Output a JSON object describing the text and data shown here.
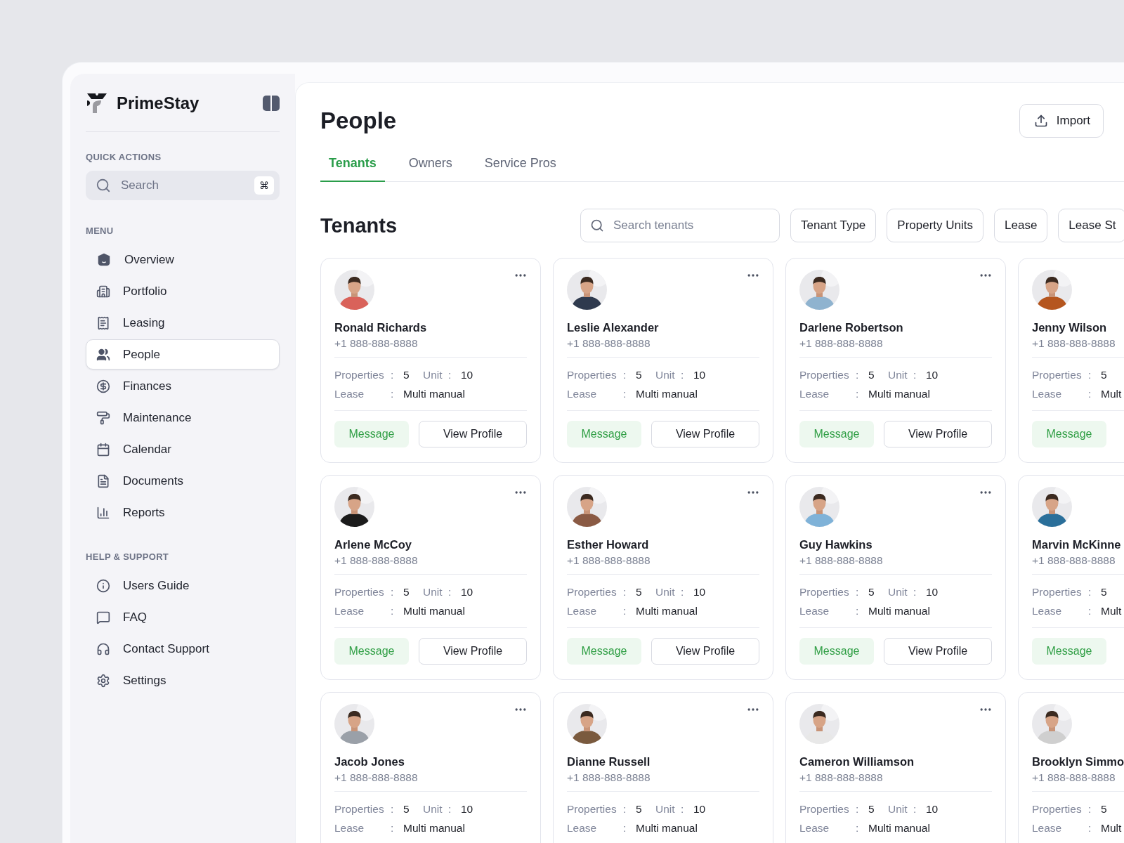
{
  "app": {
    "name": "PrimeStay"
  },
  "sidebar": {
    "quick_actions_label": "QUICK ACTIONS",
    "search": {
      "placeholder": "Search",
      "shortcut": "⌘"
    },
    "menu_label": "MENU",
    "menu": [
      {
        "label": "Overview",
        "selected": false
      },
      {
        "label": "Portfolio",
        "selected": false
      },
      {
        "label": "Leasing",
        "selected": false
      },
      {
        "label": "People",
        "selected": true
      },
      {
        "label": "Finances",
        "selected": false
      },
      {
        "label": "Maintenance",
        "selected": false
      },
      {
        "label": "Calendar",
        "selected": false
      },
      {
        "label": "Documents",
        "selected": false
      },
      {
        "label": "Reports",
        "selected": false
      }
    ],
    "help_label": "HELP & SUPPORT",
    "help": [
      {
        "label": "Users Guide",
        "selected": false
      },
      {
        "label": "FAQ",
        "selected": false
      },
      {
        "label": "Contact Support",
        "selected": false
      },
      {
        "label": "Settings",
        "selected": false
      }
    ]
  },
  "page": {
    "title": "People",
    "import_button": "Import",
    "tabs": [
      {
        "label": "Tenants",
        "selected": true
      },
      {
        "label": "Owners",
        "selected": false
      },
      {
        "label": "Service Pros",
        "selected": false
      }
    ],
    "section_title": "Tenants",
    "search": {
      "placeholder": "Search tenants"
    },
    "filters": [
      "Tenant Type",
      "Property Units",
      "Lease",
      "Lease St"
    ],
    "cards": [
      {
        "name": "Ronald Richards",
        "phone": "+1 888-888-8888",
        "menu": true,
        "properties_label": "Properties",
        "properties_colon": ":",
        "properties": "5",
        "unit_label": "Unit",
        "unit_colon": ":",
        "unit": "10",
        "lease_label": "Lease",
        "lease_colon": ":",
        "lease": "Multi manual",
        "actions": [
          "Message",
          "View Profile"
        ]
      },
      {
        "name": "Leslie Alexander",
        "phone": "+1 888-888-8888",
        "menu": true,
        "properties_label": "Properties",
        "properties_colon": ":",
        "properties": "5",
        "unit_label": "Unit",
        "unit_colon": ":",
        "unit": "10",
        "lease_label": "Lease",
        "lease_colon": ":",
        "lease": "Multi manual",
        "actions": [
          "Message",
          "View Profile"
        ]
      },
      {
        "name": "Darlene Robertson",
        "phone": "+1 888-888-8888",
        "menu": true,
        "properties_label": "Properties",
        "properties_colon": ":",
        "properties": "5",
        "unit_label": "Unit",
        "unit_colon": ":",
        "unit": "10",
        "lease_label": "Lease",
        "lease_colon": ":",
        "lease": "Multi manual",
        "actions": [
          "Message",
          "View Profile"
        ]
      },
      {
        "name": "Jenny Wilson",
        "phone": "+1 888-888-8888",
        "menu": false,
        "properties_label": "Properties",
        "properties_colon": ":",
        "properties": "5",
        "lease_label": "Lease",
        "lease_colon": ":",
        "lease": "Mult",
        "actions": [
          "Message"
        ]
      },
      {
        "name": "Arlene McCoy",
        "phone": "+1 888-888-8888",
        "menu": true,
        "properties_label": "Properties",
        "properties_colon": ":",
        "properties": "5",
        "unit_label": "Unit",
        "unit_colon": ":",
        "unit": "10",
        "lease_label": "Lease",
        "lease_colon": ":",
        "lease": "Multi manual",
        "actions": [
          "Message",
          "View Profile"
        ]
      },
      {
        "name": "Esther Howard",
        "phone": "+1 888-888-8888",
        "menu": true,
        "properties_label": "Properties",
        "properties_colon": ":",
        "properties": "5",
        "unit_label": "Unit",
        "unit_colon": ":",
        "unit": "10",
        "lease_label": "Lease",
        "lease_colon": ":",
        "lease": "Multi manual",
        "actions": [
          "Message",
          "View Profile"
        ]
      },
      {
        "name": "Guy Hawkins",
        "phone": "+1 888-888-8888",
        "menu": true,
        "properties_label": "Properties",
        "properties_colon": ":",
        "properties": "5",
        "unit_label": "Unit",
        "unit_colon": ":",
        "unit": "10",
        "lease_label": "Lease",
        "lease_colon": ":",
        "lease": "Multi manual",
        "actions": [
          "Message",
          "View Profile"
        ]
      },
      {
        "name": "Marvin McKinne",
        "phone": "+1 888-888-8888",
        "menu": false,
        "properties_label": "Properties",
        "properties_colon": ":",
        "properties": "5",
        "lease_label": "Lease",
        "lease_colon": ":",
        "lease": "Mult",
        "actions": [
          "Message"
        ]
      },
      {
        "name": "Jacob Jones",
        "phone": "+1 888-888-8888",
        "menu": true,
        "properties_label": "Properties",
        "properties_colon": ":",
        "properties": "5",
        "unit_label": "Unit",
        "unit_colon": ":",
        "unit": "10",
        "lease_label": "Lease",
        "lease_colon": ":",
        "lease": "Multi manual"
      },
      {
        "name": "Dianne Russell",
        "phone": "+1 888-888-8888",
        "menu": true,
        "properties_label": "Properties",
        "properties_colon": ":",
        "properties": "5",
        "unit_label": "Unit",
        "unit_colon": ":",
        "unit": "10",
        "lease_label": "Lease",
        "lease_colon": ":",
        "lease": "Multi manual"
      },
      {
        "name": "Cameron Williamson",
        "phone": "+1 888-888-8888",
        "menu": true,
        "properties_label": "Properties",
        "properties_colon": ":",
        "properties": "5",
        "unit_label": "Unit",
        "unit_colon": ":",
        "unit": "10",
        "lease_label": "Lease",
        "lease_colon": ":",
        "lease": "Multi manual"
      },
      {
        "name": "Brooklyn Simmo",
        "phone": "+1 888-888-8888",
        "menu": false,
        "properties_label": "Properties",
        "properties_colon": ":",
        "properties": "5",
        "lease_label": "Lease",
        "lease_colon": ":",
        "lease": "Mult"
      }
    ]
  }
}
